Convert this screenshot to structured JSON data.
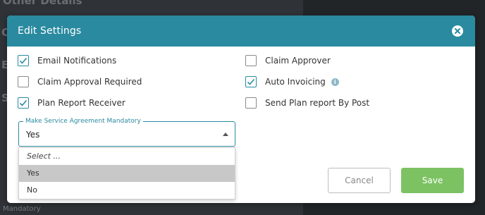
{
  "background": {
    "title": "Other Details",
    "fragments": [
      "C",
      "E",
      "S"
    ],
    "mandatory_label": "Mandatory"
  },
  "modal": {
    "title": "Edit Settings",
    "close_icon": "close-circle-icon",
    "options": {
      "email_notifications": {
        "label": "Email Notifications",
        "checked": true
      },
      "claim_approver": {
        "label": "Claim Approver",
        "checked": false
      },
      "claim_approval_required": {
        "label": "Claim Approval Required",
        "checked": false
      },
      "auto_invoicing": {
        "label": "Auto Invoicing",
        "checked": true,
        "info_icon": "info-icon"
      },
      "plan_report_receiver": {
        "label": "Plan Report Receiver",
        "checked": true
      },
      "send_plan_report_by_post": {
        "label": "Send Plan report By Post",
        "checked": false
      }
    },
    "service_agreement": {
      "label": "Make Service Agreement Mandatory",
      "value": "Yes",
      "dropdown_options": [
        "Select ...",
        "Yes",
        "No"
      ],
      "highlighted_option": "Yes"
    },
    "buttons": {
      "cancel": "Cancel",
      "save": "Save"
    }
  },
  "colors": {
    "header": "#2a8aa0",
    "save_button": "#7cc263",
    "checkbox_accent": "#2a8aa0"
  }
}
